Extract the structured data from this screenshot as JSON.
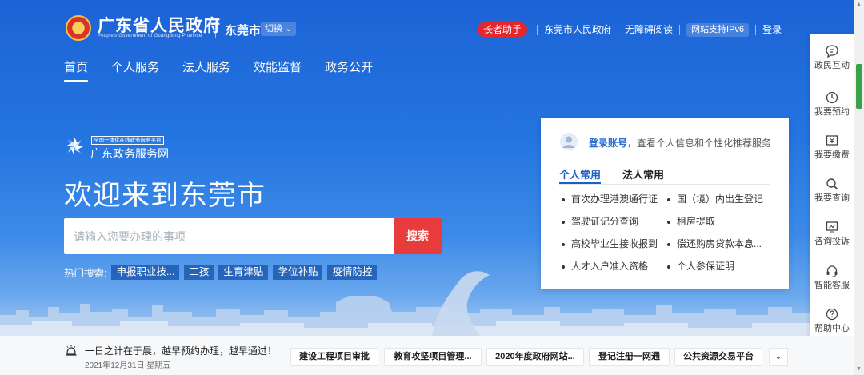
{
  "header": {
    "title": "广东省人民政府",
    "subtitle": "People's Government of Guangdong Province",
    "city": "东莞市",
    "switch_label": "切换",
    "links": {
      "elder": "长者助手",
      "city_gov": "东莞市人民政府",
      "accessible": "无障碍阅读",
      "ipv6": "网站支持IPv6",
      "login": "登录"
    }
  },
  "nav": {
    "items": [
      "首页",
      "个人服务",
      "法人服务",
      "效能监督",
      "政务公开"
    ],
    "active": "首页"
  },
  "hero": {
    "platform_small": "全国一体化在线政务服务平台",
    "platform_name": "广东政务服务网",
    "welcome": "欢迎来到东莞市",
    "search_placeholder": "请输入您要办理的事项",
    "search_button": "搜索",
    "hot_label": "热门搜索:",
    "hot_tags": [
      "申报职业技...",
      "二孩",
      "生育津贴",
      "学位补贴",
      "疫情防控"
    ]
  },
  "card": {
    "login_link": "登录账号",
    "login_text": "，查看个人信息和个性化推荐服务",
    "tabs": [
      "个人常用",
      "法人常用"
    ],
    "active_tab": "个人常用",
    "services": [
      "首次办理港澳通行证",
      "国（境）内出生登记",
      "驾驶证记分查询",
      "租房提取",
      "高校毕业生接收报到",
      "偿还购房贷款本息...",
      "人才入户准入资格",
      "个人参保证明"
    ]
  },
  "rail": {
    "items": [
      {
        "label": "政民互动",
        "icon": "chat-icon"
      },
      {
        "label": "我要预约",
        "icon": "clock-icon"
      },
      {
        "label": "我要缴费",
        "icon": "payment-icon"
      },
      {
        "label": "我要查询",
        "icon": "search-icon"
      },
      {
        "label": "咨询投诉",
        "icon": "complaint-icon"
      },
      {
        "label": "智能客服",
        "icon": "headset-icon"
      },
      {
        "label": "帮助中心",
        "icon": "help-icon"
      }
    ]
  },
  "bottom": {
    "notice": "一日之计在于晨，越早预约办理，越早通过！",
    "date": "2021年12月31日 星期五",
    "quick_links": [
      "建设工程项目审批",
      "教育攻坚项目管理...",
      "2020年度政府网站...",
      "登记注册一网通",
      "公共资源交易平台"
    ]
  },
  "colors": {
    "primary_blue": "#1c63d6",
    "accent_red": "#e83b3b",
    "scroll_thumb": "#3aa04a"
  }
}
